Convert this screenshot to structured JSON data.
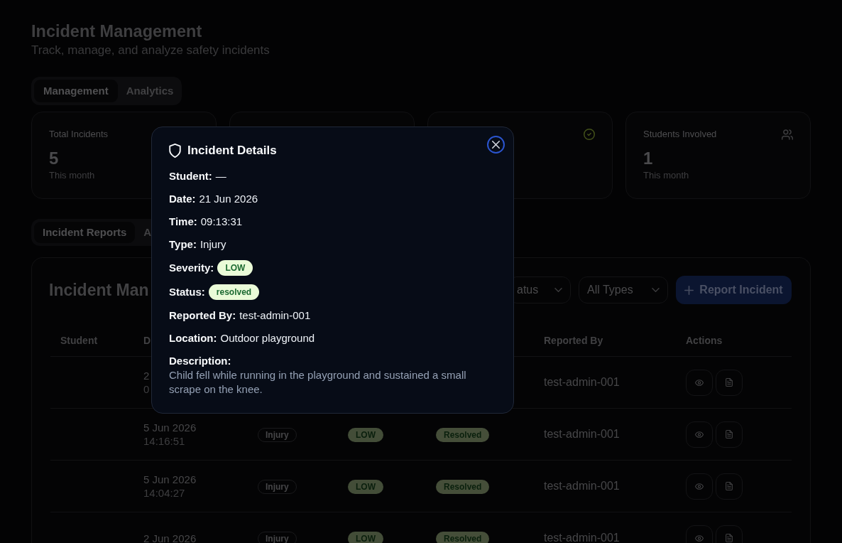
{
  "header": {
    "title": "Incident Management",
    "subtitle": "Track, manage, and analyze safety incidents"
  },
  "tabs": [
    {
      "label": "Management",
      "selected": true
    },
    {
      "label": "Analytics",
      "selected": false
    }
  ],
  "stats": [
    {
      "kind": "plain",
      "label": "Total Incidents",
      "value": "5",
      "note": "This month"
    },
    {
      "kind": "blank"
    },
    {
      "kind": "checkmark"
    },
    {
      "kind": "people",
      "label": "Students Involved",
      "value": "1",
      "note": "This month"
    }
  ],
  "report_tabs": [
    {
      "label": "Incident Reports",
      "selected": true
    },
    {
      "label": "A",
      "selected": false
    }
  ],
  "panel": {
    "title": "Incident Man",
    "filters": [
      {
        "value": "atus"
      },
      {
        "value": "All Types"
      }
    ],
    "button": "Report Incident"
  },
  "table": {
    "columns": [
      {
        "label": "Student"
      },
      {
        "label": "D"
      },
      {},
      {},
      {},
      {
        "label": "Reported By"
      },
      {
        "label": "Actions"
      }
    ],
    "rows": [
      {
        "date": "2",
        "time": "0",
        "reported_by": "test-admin-001"
      },
      {
        "date": "5 Jun 2026",
        "time": "14:16:51",
        "type": "Injury",
        "severity": "LOW",
        "status": "Resolved",
        "reported_by": "test-admin-001"
      },
      {
        "date": "5 Jun 2026",
        "time": "14:04:27",
        "type": "Injury",
        "severity": "LOW",
        "status": "Resolved",
        "reported_by": "test-admin-001"
      },
      {
        "date": "2 Jun 2026",
        "type": "Injury",
        "severity": "LOW",
        "status": "Resolved",
        "reported_by": "test-admin-001"
      }
    ]
  },
  "dialog": {
    "title": "Incident Details",
    "fields": [
      {
        "kind": "text",
        "label": "Student:",
        "value": "—"
      },
      {
        "kind": "text",
        "label": "Date:",
        "value": "21 Jun 2026"
      },
      {
        "kind": "text",
        "label": "Time:",
        "value": "09:13:31"
      },
      {
        "kind": "text",
        "label": "Type:",
        "value": "Injury"
      },
      {
        "kind": "badge",
        "label": "Severity:",
        "value": "LOW"
      },
      {
        "kind": "badge",
        "label": "Status:",
        "value": "resolved"
      },
      {
        "kind": "text",
        "label": "Reported By:",
        "value": "test-admin-001"
      },
      {
        "kind": "text",
        "label": "Location:",
        "value": "Outdoor playground"
      }
    ],
    "description_label": "Description:",
    "description": "Child fell while running in the playground and sustained a small scrape on the knee."
  }
}
